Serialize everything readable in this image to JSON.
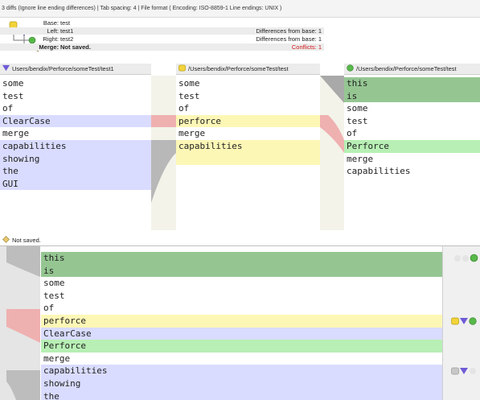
{
  "status_bar": "3 diffs (Ignore line ending differences) | Tab spacing: 4 | File format ( Encoding: ISO-8859-1  Line endings: UNIX )",
  "info": {
    "base_label": "Base:",
    "base_value": "test",
    "left_label": "Left:",
    "left_value": "test1",
    "left_diff": "Differences from base: 1",
    "right_label": "Right:",
    "right_value": "test2",
    "right_diff": "Differences from base: 1",
    "merge_label": "Merge:",
    "merge_value": "Not saved.",
    "conflicts": "Conflicts: 1"
  },
  "panes": {
    "left": {
      "path": "Users/bendix/Perforce/someTest/test1",
      "lines": [
        "some",
        "test",
        "of",
        "ClearCase",
        "merge",
        "capabilities",
        "showing",
        "the",
        "GUI"
      ]
    },
    "base": {
      "path": "/Users/bendix/Perforce/someTest/test",
      "lines": [
        "some",
        "test",
        "of",
        "perforce",
        "merge",
        "capabilities"
      ]
    },
    "right": {
      "path": "/Users/bendix/Perforce/someTest/test",
      "lines": [
        "this",
        "is",
        "some",
        "test",
        "of",
        "Perforce",
        "merge",
        "capabilities"
      ]
    }
  },
  "message": "Not saved.",
  "merge": {
    "lines": [
      "this",
      "is",
      "some",
      "test",
      "of",
      "perforce",
      "ClearCase",
      "Perforce",
      "merge",
      "capabilities",
      "showing",
      "the"
    ]
  },
  "colors": {
    "left_icon": "#6e5bd6",
    "base_icon": "#f2d33a",
    "right_icon": "#58b84a",
    "conflict": "#d01818"
  }
}
